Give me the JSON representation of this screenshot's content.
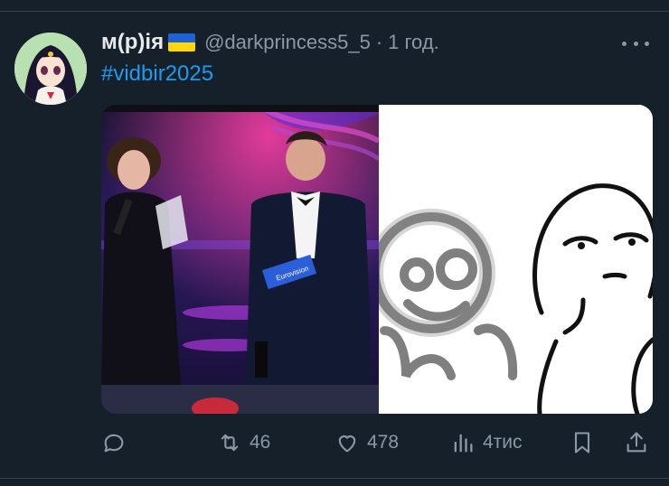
{
  "post": {
    "display_name": "м(р)ія",
    "handle": "@darkprincess5_5",
    "separator": "·",
    "time": "1 год.",
    "hashtag": "#vidbir2025"
  },
  "media": {
    "left_photo_badge": "Eurovision"
  },
  "actions": {
    "reposts": "46",
    "likes": "478",
    "views": "4тис"
  },
  "icons": [
    "reply-icon",
    "repost-icon",
    "like-icon",
    "views-icon",
    "bookmark-icon",
    "share-icon",
    "more-icon"
  ]
}
